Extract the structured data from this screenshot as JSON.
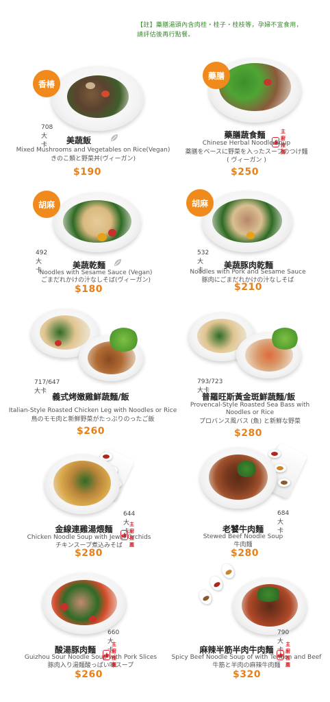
{
  "note": {
    "line1": "【註】藥膳湯頭內含肉桂・桂子・桂枝等，孕婦不宜食用，",
    "line2": "請評估後再行點餐。"
  },
  "recommend_label": "主廚推薦",
  "icons": {
    "vegan": "leaf-icon",
    "recommend": "thumbs-up-icon"
  },
  "colors": {
    "accent": "#f08a1c",
    "price": "#e8801a",
    "note": "#3a8a2e",
    "recommend": "#d8232a"
  },
  "items": [
    {
      "tag": "香椿",
      "kcal": "708大卡",
      "name": "美蔬飯",
      "en": "Mixed Mushrooms and Vegetables on Rice(Vegan)",
      "jp": "きのこ類と野菜丼(ヴィーガン)",
      "price": "$190",
      "vegan": true,
      "recommended": false
    },
    {
      "tag": "藥膳",
      "kcal": "",
      "name": "藥膳蔬食麵",
      "en": "Chinese Herbal Noodle Soup",
      "jp": "薬膳をベースに野菜を入ったスープのつけ麵",
      "jp2": "( ヴィーガン )",
      "price": "$250",
      "vegan": false,
      "recommended": true
    },
    {
      "tag": "胡麻",
      "kcal": "492大卡",
      "name": "美蔬乾麵",
      "en": "Noodles with Sesame Sauce (Vegan)",
      "jp": "ごまだれかけの汁なしそば(ヴィーガン)",
      "price": "$180",
      "vegan": true,
      "recommended": false
    },
    {
      "tag": "胡麻",
      "kcal": "532大卡",
      "name": "美蔬豚肉乾麵",
      "en": "Noodles with Pork and Sesame Sauce",
      "jp": "豚肉にごまだれかけの汁なしそば",
      "price": "$210",
      "vegan": false,
      "recommended": false
    },
    {
      "tag": "",
      "kcal": "717/647大卡",
      "name": "義式烤嫩雞鮮蔬麵/飯",
      "en": "Italian-Style Roasted Chicken Leg with Noodles or Rice",
      "jp": "鳥のモモ肉と新鮮野菜がたっぷりのったご飯",
      "price": "$260",
      "vegan": false,
      "recommended": false
    },
    {
      "tag": "",
      "kcal": "793/723大卡",
      "name": "普羅旺斯黃金斑鮮蔬麵/飯",
      "en": "Provencal-Style Roasted Sea Bass with Noodles or Rice",
      "jp": "プロバンス風バス (魚) と新鮮な野菜",
      "price": "$280",
      "vegan": false,
      "recommended": false
    },
    {
      "tag": "",
      "kcal": "644大卡",
      "name": "金線連雞湯煨麵",
      "en": "Chicken Noodle Soup with Jewel Orchids",
      "jp": "チキンスープ煮込みそば",
      "price": "$280",
      "vegan": false,
      "recommended": true
    },
    {
      "tag": "",
      "kcal": "684大卡",
      "name": "老饕牛肉麵",
      "en": "Stewed Beef Noodle Soup",
      "jp": "牛肉麵",
      "price": "$280",
      "vegan": false,
      "recommended": false
    },
    {
      "tag": "",
      "kcal": "660大卡",
      "name": "酸湯豚肉麵",
      "en": "Guizhou Sour Noodle Soup with Pork Slices",
      "jp": "豚肉入り湯麵酸っぱい味スープ",
      "price": "$260",
      "vegan": false,
      "recommended": true
    },
    {
      "tag": "",
      "kcal": "790大卡",
      "name": "麻辣半筋半肉牛肉麵",
      "en": "Spicy Beef Noodle Soup of with Tendon and Beef",
      "jp": "牛筋と半肉の麻辣牛肉麵",
      "price": "$320",
      "vegan": false,
      "recommended": true
    }
  ]
}
